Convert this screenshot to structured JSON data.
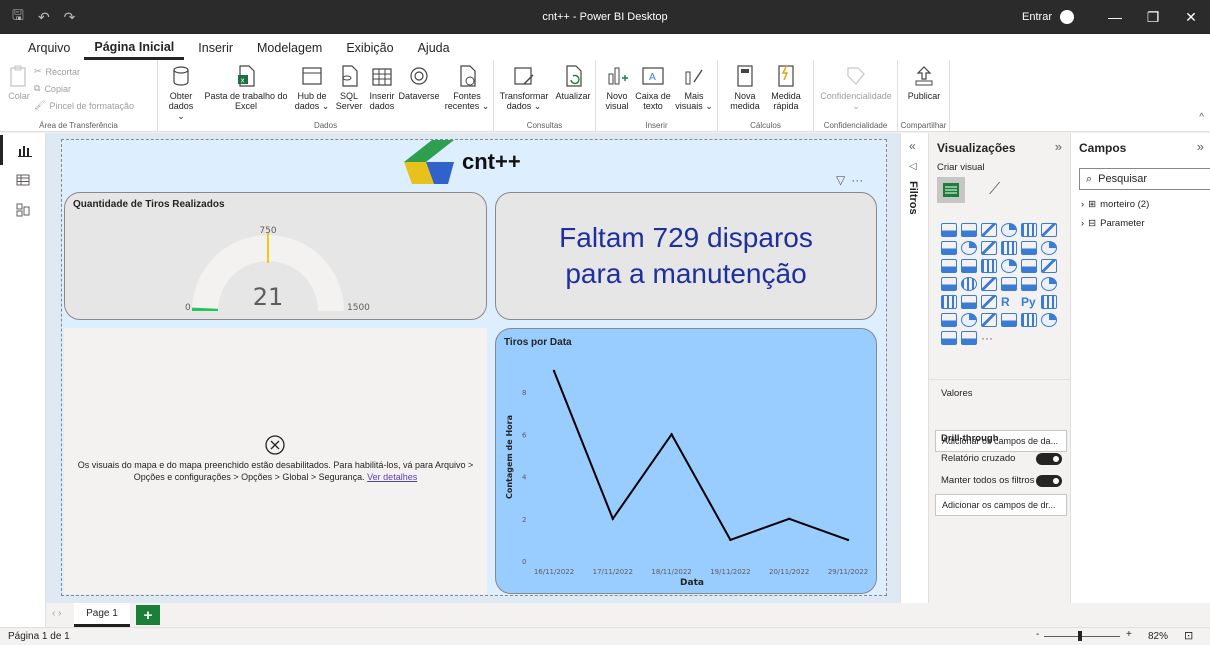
{
  "titlebar": {
    "title": "cnt++ - Power BI Desktop",
    "signin": "Entrar"
  },
  "menu": {
    "tabs": [
      "Arquivo",
      "Página Inicial",
      "Inserir",
      "Modelagem",
      "Exibição",
      "Ajuda"
    ],
    "active": "Página Inicial"
  },
  "ribbon": {
    "clipboard": {
      "paste": "Colar",
      "cut": "Recortar",
      "copy": "Copiar",
      "format_painter": "Pincel de formatação",
      "label": "Área de Transferência"
    },
    "data": {
      "get_data": [
        "Obter",
        "dados ⌄"
      ],
      "excel": [
        "Pasta de trabalho do",
        "Excel"
      ],
      "hub": [
        "Hub de",
        "dados ⌄"
      ],
      "sql": [
        "SQL",
        "Server"
      ],
      "enter_data": [
        "Inserir",
        "dados"
      ],
      "dataverse": [
        "Dataverse",
        ""
      ],
      "recent": [
        "Fontes",
        "recentes ⌄"
      ],
      "label": "Dados"
    },
    "queries": {
      "transform": [
        "Transformar",
        "dados ⌄"
      ],
      "refresh": [
        "Atualizar",
        ""
      ],
      "label": "Consultas"
    },
    "insert": {
      "new_visual": [
        "Novo",
        "visual"
      ],
      "textbox": [
        "Caixa de",
        "texto"
      ],
      "more_visuals": [
        "Mais",
        "visuais ⌄"
      ],
      "label": "Inserir"
    },
    "calc": {
      "new_measure": [
        "Nova",
        "medida"
      ],
      "quick_measure": [
        "Medida",
        "rápida"
      ],
      "label": "Cálculos"
    },
    "sensitivity": {
      "button": [
        "Confidencialidade",
        "⌄"
      ],
      "label": "Confidencialidade"
    },
    "share": {
      "publish": [
        "Publicar",
        ""
      ],
      "label": "Compartilhar"
    }
  },
  "canvas": {
    "logo_text": "cnt++",
    "gauge": {
      "title": "Quantidade de Tiros Realizados",
      "value": 21,
      "min": 0,
      "max": 1500,
      "target": 750,
      "value_label": "21",
      "min_label": "0",
      "max_label": "1500",
      "target_label": "750"
    },
    "card_message": [
      "Faltam 729 disparos",
      "para a manutenção"
    ],
    "map": {
      "message_line1": "Os visuais do mapa e do mapa preenchido estão desabilitados. Para habilitá-los, vá para Arquivo >",
      "message_line2": "Opções e configurações > Opções > Global > Segurança. ",
      "link": "Ver detalhes"
    }
  },
  "chart_data": {
    "type": "line",
    "title": "Tiros por Data",
    "xlabel": "Data",
    "ylabel": "Contagem de Hora",
    "categories": [
      "16/11/2022",
      "17/11/2022",
      "18/11/2022",
      "19/11/2022",
      "20/11/2022",
      "29/11/2022"
    ],
    "values": [
      9,
      2,
      6,
      1,
      2,
      1
    ],
    "ylim": [
      0,
      9
    ],
    "yticks": [
      0,
      2,
      4,
      6,
      8
    ],
    "grid": false
  },
  "filters": {
    "label": "Filtros"
  },
  "visualizations": {
    "title": "Visualizações",
    "subtitle": "Criar visual",
    "values_label": "Valores",
    "values_placeholder": "Adicionar os campos de da...",
    "drillthrough_label": "Drill-through",
    "cross_report": "Relatório cruzado",
    "keep_filters": "Manter todos os filtros",
    "drill_placeholder": "Adicionar os campos de dr...",
    "r_label": "R",
    "py_label": "Py",
    "more": "···"
  },
  "fields": {
    "title": "Campos",
    "search_placeholder": "Pesquisar",
    "tables": [
      "morteiro (2)",
      "Parameter"
    ]
  },
  "pages": {
    "tab": "Page 1",
    "add": "+"
  },
  "status": {
    "page": "Página 1 de 1",
    "zoom": "82%"
  }
}
